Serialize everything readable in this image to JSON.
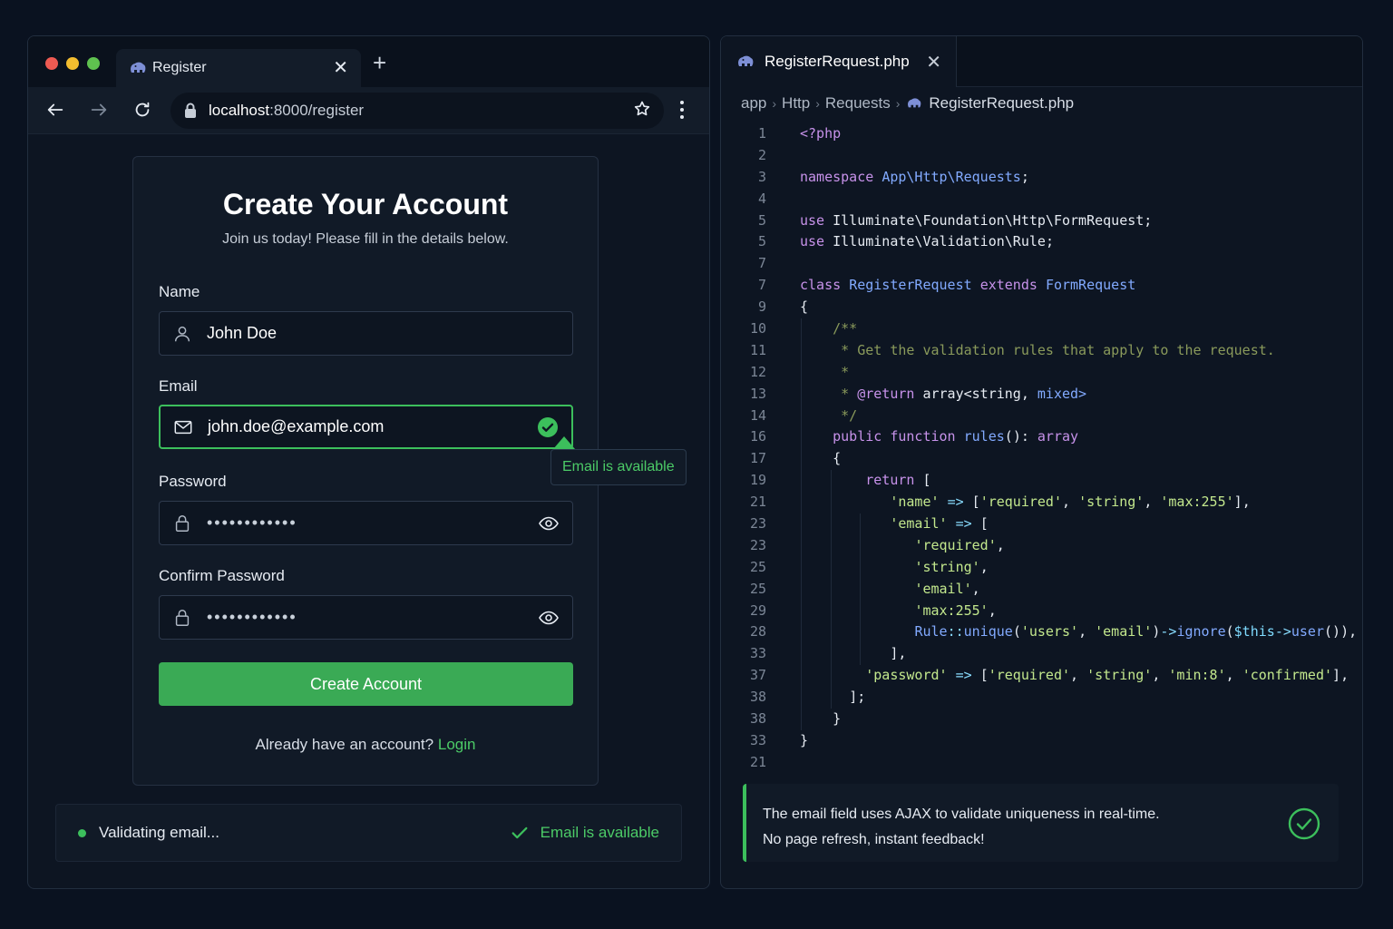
{
  "browser": {
    "tab": {
      "title": "Register",
      "close": "✕"
    },
    "new_tab": "+",
    "url_host": "localhost",
    "url_path": ":8000/register"
  },
  "form": {
    "title": "Create Your Account",
    "subtitle": "Join us today! Please fill in the details below.",
    "name_label": "Name",
    "name_value": "John Doe",
    "email_label": "Email",
    "email_value": "john.doe@example.com",
    "password_label": "Password",
    "password_mask": "••••••••••••",
    "confirm_label": "Confirm Password",
    "confirm_mask": "••••••••••••",
    "tooltip": "Email is available",
    "submit_label": "Create Account",
    "login_prompt": "Already have an account?",
    "login_link": "Login"
  },
  "status": {
    "validating": "Validating email...",
    "result": "Email is available"
  },
  "editor": {
    "tab_title": "RegisterRequest.php",
    "tab_close": "✕",
    "breadcrumbs": [
      "app",
      "Http",
      "Requests"
    ],
    "breadcrumb_file": "RegisterRequest.php",
    "info_line1": "The email field uses AJAX to validate uniqueness in real-time.",
    "info_line2": "No page refresh, instant feedback!"
  },
  "code_lines": [
    {
      "n": "1",
      "t": "<?php"
    },
    {
      "n": "2",
      "t": ""
    },
    {
      "n": "3",
      "t": "namespace App\\Http\\Requests;"
    },
    {
      "n": "4",
      "t": ""
    },
    {
      "n": "5",
      "t": "use Illuminate\\Foundation\\Http\\FormRequest;"
    },
    {
      "n": "5",
      "t": "use Illuminate\\Validation\\Rule;"
    },
    {
      "n": "7",
      "t": ""
    },
    {
      "n": "7",
      "t": "class RegisterRequest extends FormRequest"
    },
    {
      "n": "9",
      "t": "{"
    },
    {
      "n": "10",
      "t": "    /**"
    },
    {
      "n": "11",
      "t": "     * Get the validation rules that apply to the request."
    },
    {
      "n": "12",
      "t": "     *"
    },
    {
      "n": "13",
      "t": "     * @return array<string, mixed>"
    },
    {
      "n": "14",
      "t": "     */"
    },
    {
      "n": "16",
      "t": "    public function rules(): array"
    },
    {
      "n": "17",
      "t": "    {"
    },
    {
      "n": "19",
      "t": "        return ["
    },
    {
      "n": "21",
      "t": "           'name' => ['required', 'string', 'max:255'],"
    },
    {
      "n": "23",
      "t": "           'email' => ["
    },
    {
      "n": "23",
      "t": "              'required',"
    },
    {
      "n": "25",
      "t": "              'string',"
    },
    {
      "n": "25",
      "t": "              'email',"
    },
    {
      "n": "29",
      "t": "              'max:255',"
    },
    {
      "n": "28",
      "t": "              Rule::unique('users', 'email')->ignore($this->user()),"
    },
    {
      "n": "33",
      "t": "           ],"
    },
    {
      "n": "37",
      "t": "        'password' => ['required', 'string', 'min:8', 'confirmed'],"
    },
    {
      "n": "38",
      "t": "      ];"
    },
    {
      "n": "38",
      "t": "    }"
    },
    {
      "n": "33",
      "t": "}"
    },
    {
      "n": "21",
      "t": ""
    }
  ],
  "colors": {
    "accent_green": "#3cbf5c",
    "button_green": "#3aaa55",
    "background": "#0a1220"
  },
  "icons": [
    "back-arrow-icon",
    "forward-arrow-icon",
    "reload-icon",
    "lock-icon",
    "star-icon",
    "menu-icon",
    "user-icon",
    "mail-icon",
    "check-circle-icon",
    "eye-icon",
    "php-elephant-icon"
  ]
}
